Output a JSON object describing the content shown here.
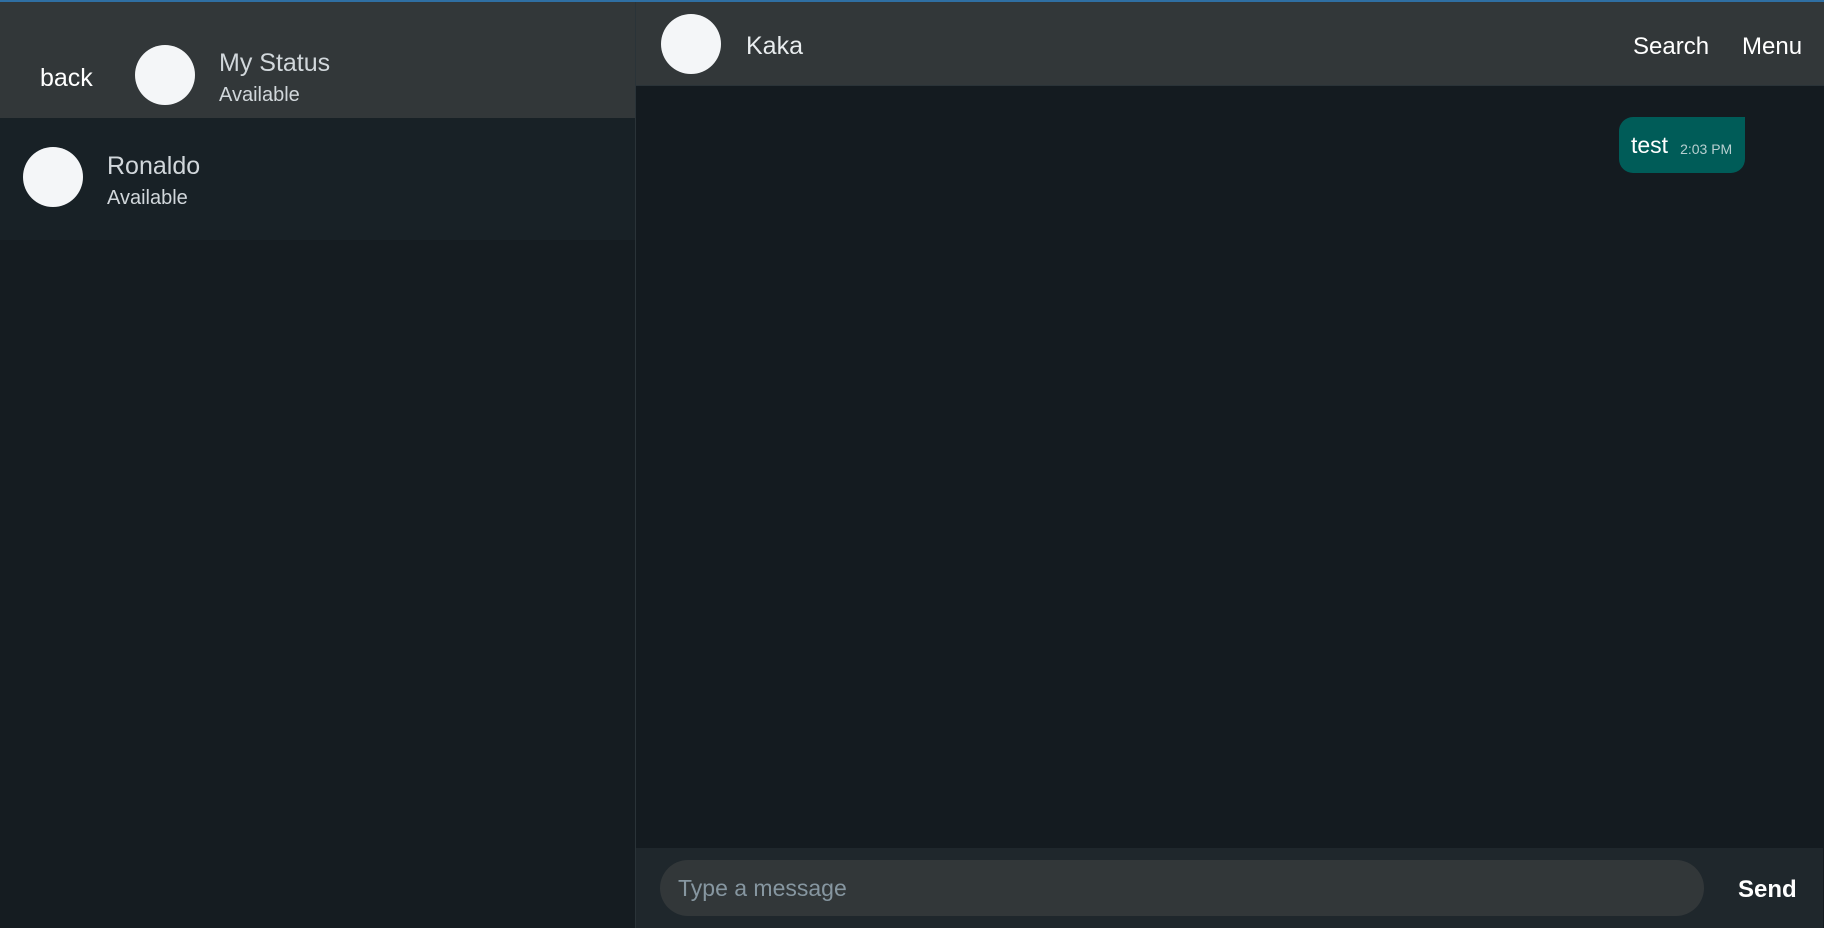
{
  "sidebar": {
    "back_label": "back",
    "me": {
      "name": "My Status",
      "status": "Available"
    },
    "contacts": [
      {
        "name": "Ronaldo",
        "status": "Available"
      }
    ]
  },
  "chat": {
    "contact_name": "Kaka",
    "search_label": "Search",
    "menu_label": "Menu",
    "messages": [
      {
        "text": "test",
        "time": "2:03 PM",
        "direction": "outgoing"
      }
    ],
    "composer": {
      "placeholder": "Type a message",
      "value": "",
      "send_label": "Send"
    }
  },
  "colors": {
    "header_bg": "#323739",
    "panel_bg": "#151c21",
    "outgoing_bubble": "#005c58",
    "avatar": "#f4f6f8",
    "top_accent": "#2f6fa3"
  }
}
